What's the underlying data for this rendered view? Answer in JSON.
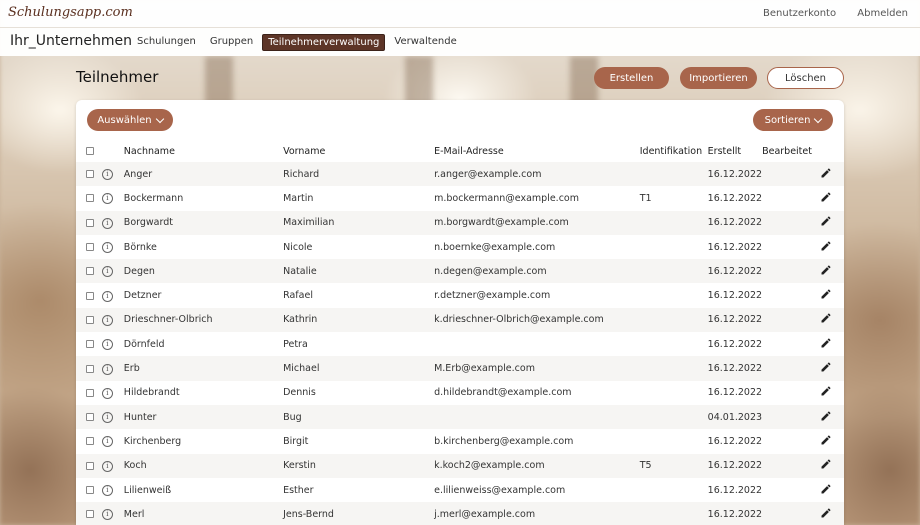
{
  "header": {
    "logo": "Schulungsapp.com",
    "account_link": "Benutzerkonto",
    "logout_link": "Abmelden"
  },
  "nav": {
    "company": "Ihr_Unternehmen",
    "tabs": [
      {
        "label": "Schulungen"
      },
      {
        "label": "Gruppen"
      },
      {
        "label": "Teilnehmerverwaltung"
      },
      {
        "label": "Verwaltende"
      }
    ]
  },
  "page": {
    "title": "Teilnehmer",
    "create_label": "Erstellen",
    "import_label": "Importieren",
    "delete_label": "Löschen",
    "select_label": "Auswählen",
    "sort_label": "Sortieren"
  },
  "table": {
    "columns": {
      "last": "Nachname",
      "first": "Vorname",
      "email": "E-Mail-Adresse",
      "id": "Identifikation",
      "created": "Erstellt",
      "edited": "Bearbeitet"
    },
    "info_glyph": "i",
    "rows": [
      {
        "last": "Anger",
        "first": "Richard",
        "email": "r.anger@example.com",
        "id": "",
        "created": "16.12.2022"
      },
      {
        "last": "Bockermann",
        "first": "Martin",
        "email": "m.bockermann@example.com",
        "id": "T1",
        "created": "16.12.2022"
      },
      {
        "last": "Borgwardt",
        "first": "Maximilian",
        "email": "m.borgwardt@example.com",
        "id": "",
        "created": "16.12.2022"
      },
      {
        "last": "Börnke",
        "first": "Nicole",
        "email": "n.boernke@example.com",
        "id": "",
        "created": "16.12.2022"
      },
      {
        "last": "Degen",
        "first": "Natalie",
        "email": "n.degen@example.com",
        "id": "",
        "created": "16.12.2022"
      },
      {
        "last": "Detzner",
        "first": "Rafael",
        "email": "r.detzner@example.com",
        "id": "",
        "created": "16.12.2022"
      },
      {
        "last": "Drieschner-Olbrich",
        "first": "Kathrin",
        "email": "k.drieschner-Olbrich@example.com",
        "id": "",
        "created": "16.12.2022"
      },
      {
        "last": "Dörnfeld",
        "first": "Petra",
        "email": "",
        "id": "",
        "created": "16.12.2022"
      },
      {
        "last": "Erb",
        "first": "Michael",
        "email": "M.Erb@example.com",
        "id": "",
        "created": "16.12.2022"
      },
      {
        "last": "Hildebrandt",
        "first": "Dennis",
        "email": "d.hildebrandt@example.com",
        "id": "",
        "created": "16.12.2022"
      },
      {
        "last": "Hunter",
        "first": "Bug",
        "email": "",
        "id": "",
        "created": "04.01.2023"
      },
      {
        "last": "Kirchenberg",
        "first": "Birgit",
        "email": "b.kirchenberg@example.com",
        "id": "",
        "created": "16.12.2022"
      },
      {
        "last": "Koch",
        "first": "Kerstin",
        "email": "k.koch2@example.com",
        "id": "T5",
        "created": "16.12.2022"
      },
      {
        "last": "Lilienweiß",
        "first": "Esther",
        "email": "e.lilienweiss@example.com",
        "id": "",
        "created": "16.12.2022"
      },
      {
        "last": "Merl",
        "first": "Jens-Bernd",
        "email": "j.merl@example.com",
        "id": "",
        "created": "16.12.2022"
      }
    ]
  },
  "colors": {
    "accent": "#a8654b",
    "nav_active": "#5d3527",
    "logo": "#5a2f1f"
  }
}
